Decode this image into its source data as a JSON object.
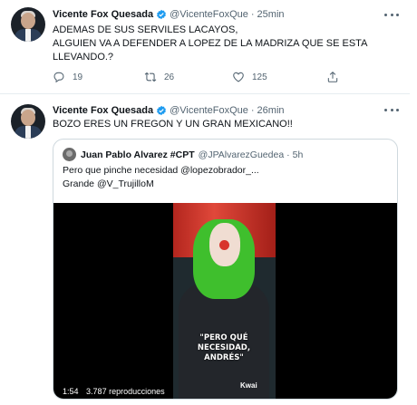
{
  "tweets": [
    {
      "author": "Vicente Fox Quesada",
      "handle": "@VicenteFoxQue",
      "dot": "·",
      "time": "25min",
      "lines": [
        "ADEMAS DE SUS SERVILES LACAYOS,",
        "ALGUIEN VA A DEFENDER A LOPEZ DE LA MADRIZA QUE SE ESTA",
        "LLEVANDO.?"
      ],
      "replies": "19",
      "retweets": "26",
      "likes": "125"
    },
    {
      "author": "Vicente Fox Quesada",
      "handle": "@VicenteFoxQue",
      "dot": "·",
      "time": "26min",
      "lines": [
        "BOZO ERES UN FREGON Y UN GRAN MEXICANO!!"
      ],
      "quote": {
        "author": "Juan Pablo Alvarez #CPT",
        "handle": "@JPAlvarezGuedea",
        "dot": "·",
        "time": "5h",
        "lines": [
          "Pero que pinche necesidad @lopezobrador_...",
          "Grande @V_TrujilloM"
        ],
        "video": {
          "duration": "1:54",
          "views": "3.787 reproducciones",
          "caption": "\"PERO QUÉ\nNECESIDAD,\nANDRÉS\"",
          "watermark": "Kwai"
        }
      }
    }
  ],
  "colors": {
    "accent": "#1d9bf0",
    "muted": "#536471",
    "border": "#cfd9de"
  },
  "icons": [
    "verified-badge-icon",
    "more-options-icon",
    "reply-icon",
    "retweet-icon",
    "like-icon",
    "share-icon"
  ]
}
